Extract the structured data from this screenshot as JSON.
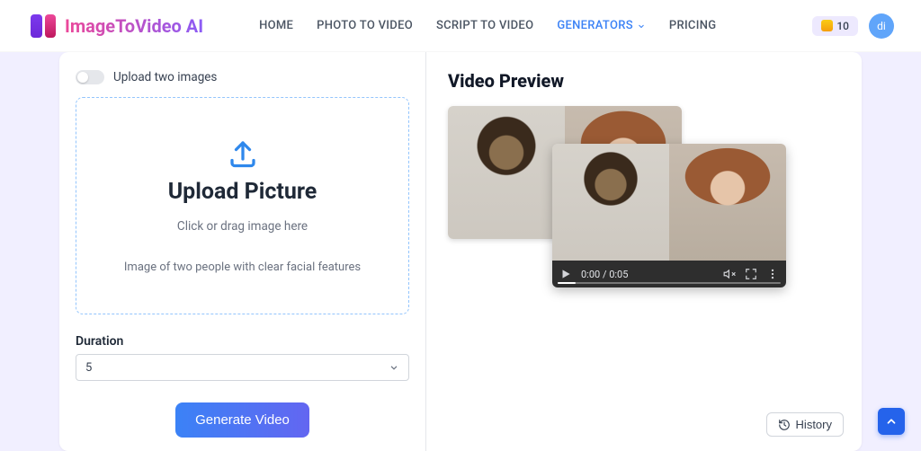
{
  "header": {
    "brand": "ImageToVideo AI",
    "nav": {
      "home": "HOME",
      "photoToVideo": "PHOTO TO VIDEO",
      "scriptToVideo": "SCRIPT TO VIDEO",
      "generators": "GENERATORS",
      "pricing": "PRICING"
    },
    "credits_value": "10",
    "avatar_initials": "di"
  },
  "left": {
    "toggle_label": "Upload two images",
    "drop_title": "Upload Picture",
    "drop_sub": "Click or drag image here",
    "drop_hint": "Image of two people with clear facial features",
    "duration_label": "Duration",
    "duration_value": "5",
    "generate_button": "Generate Video"
  },
  "right": {
    "title": "Video Preview",
    "player": {
      "time": "0:00 / 0:05"
    },
    "history_button": "History"
  }
}
